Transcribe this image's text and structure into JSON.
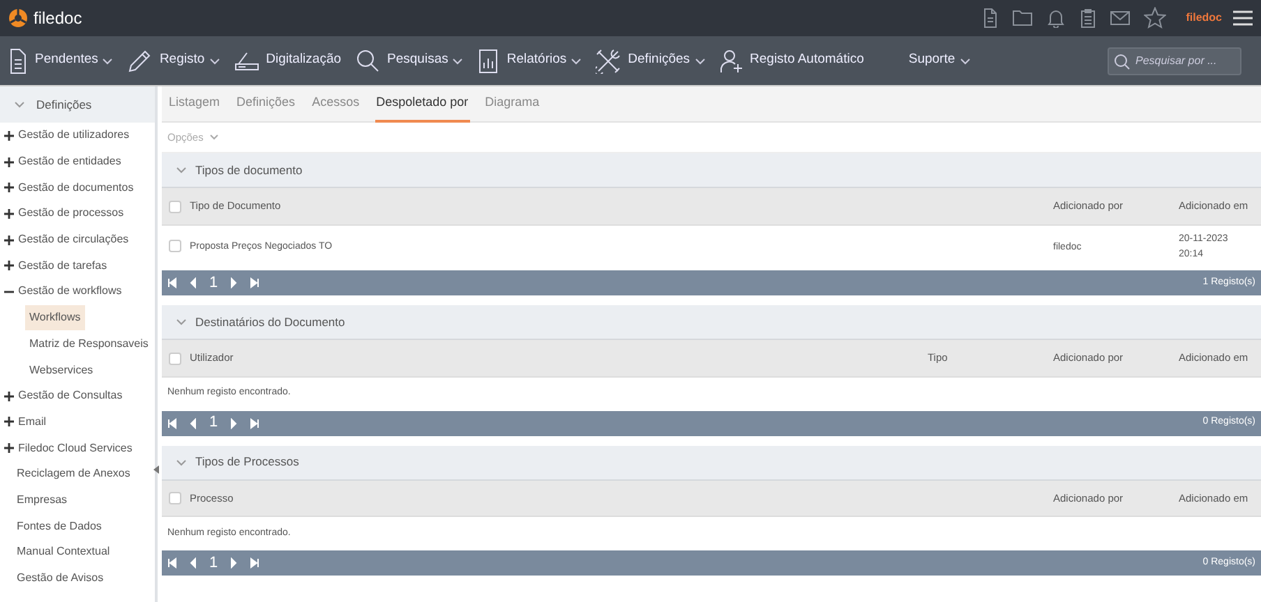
{
  "app": {
    "name": "filedoc",
    "user": "filedoc"
  },
  "menu": [
    {
      "label": "Pendentes",
      "dropdown": true
    },
    {
      "label": "Registo",
      "dropdown": true
    },
    {
      "label": "Digitalização",
      "dropdown": false
    },
    {
      "label": "Pesquisas",
      "dropdown": true
    },
    {
      "label": "Relatórios",
      "dropdown": true
    },
    {
      "label": "Definições",
      "dropdown": true
    },
    {
      "label": "Registo Automático",
      "dropdown": false
    },
    {
      "label": "Suporte",
      "dropdown": true
    }
  ],
  "search": {
    "placeholder": "Pesquisar por ..."
  },
  "sidebar": {
    "header": "Definições",
    "items": [
      {
        "label": "Gestão de utilizadores",
        "kind": "group",
        "expanded": false
      },
      {
        "label": "Gestão de entidades",
        "kind": "group",
        "expanded": false
      },
      {
        "label": "Gestão de documentos",
        "kind": "group",
        "expanded": false
      },
      {
        "label": "Gestão de processos",
        "kind": "group",
        "expanded": false
      },
      {
        "label": "Gestão de circulações",
        "kind": "group",
        "expanded": false
      },
      {
        "label": "Gestão de tarefas",
        "kind": "group",
        "expanded": false
      },
      {
        "label": "Gestão de workflows",
        "kind": "group",
        "expanded": true,
        "children": [
          {
            "label": "Workflows",
            "selected": true
          },
          {
            "label": "Matriz de Responsaveis",
            "selected": false
          },
          {
            "label": "Webservices",
            "selected": false
          }
        ]
      },
      {
        "label": "Gestão de Consultas",
        "kind": "group",
        "expanded": false
      },
      {
        "label": "Email",
        "kind": "group",
        "expanded": false
      },
      {
        "label": "Filedoc Cloud Services",
        "kind": "group",
        "expanded": false
      },
      {
        "label": "Reciclagem de Anexos",
        "kind": "link"
      },
      {
        "label": "Empresas",
        "kind": "link"
      },
      {
        "label": "Fontes de Dados",
        "kind": "link"
      },
      {
        "label": "Manual Contextual",
        "kind": "link"
      },
      {
        "label": "Gestão de Avisos",
        "kind": "link"
      }
    ]
  },
  "tabs": [
    {
      "label": "Listagem",
      "selected": false
    },
    {
      "label": "Definições",
      "selected": false
    },
    {
      "label": "Acessos",
      "selected": false
    },
    {
      "label": "Despoletado por",
      "selected": true
    },
    {
      "label": "Diagrama",
      "selected": false
    }
  ],
  "options": "Opções",
  "sections": [
    {
      "title": "Tipos de documento",
      "columns": [
        "Tipo de Documento",
        "Adicionado por",
        "Adicionado em"
      ],
      "all_checked": false,
      "rows": [
        {
          "checked": false,
          "cells": [
            "Proposta Preços Negociados TO",
            "filedoc",
            "20-11-2023 20:14"
          ]
        }
      ],
      "page": "1",
      "count": "1 Registo(s)"
    },
    {
      "title": "Destinatários do Documento",
      "columns": [
        "Utilizador",
        "Tipo",
        "Adicionado por",
        "Adicionado em"
      ],
      "all_checked": false,
      "empty": "Nenhum registo encontrado.",
      "page": "1",
      "count": "0 Registo(s)"
    },
    {
      "title": "Tipos de Processos",
      "columns": [
        "Processo",
        "Adicionado por",
        "Adicionado em"
      ],
      "all_checked": false,
      "empty": "Nenhum registo encontrado.",
      "page": "1",
      "count": "0 Registo(s)"
    }
  ]
}
